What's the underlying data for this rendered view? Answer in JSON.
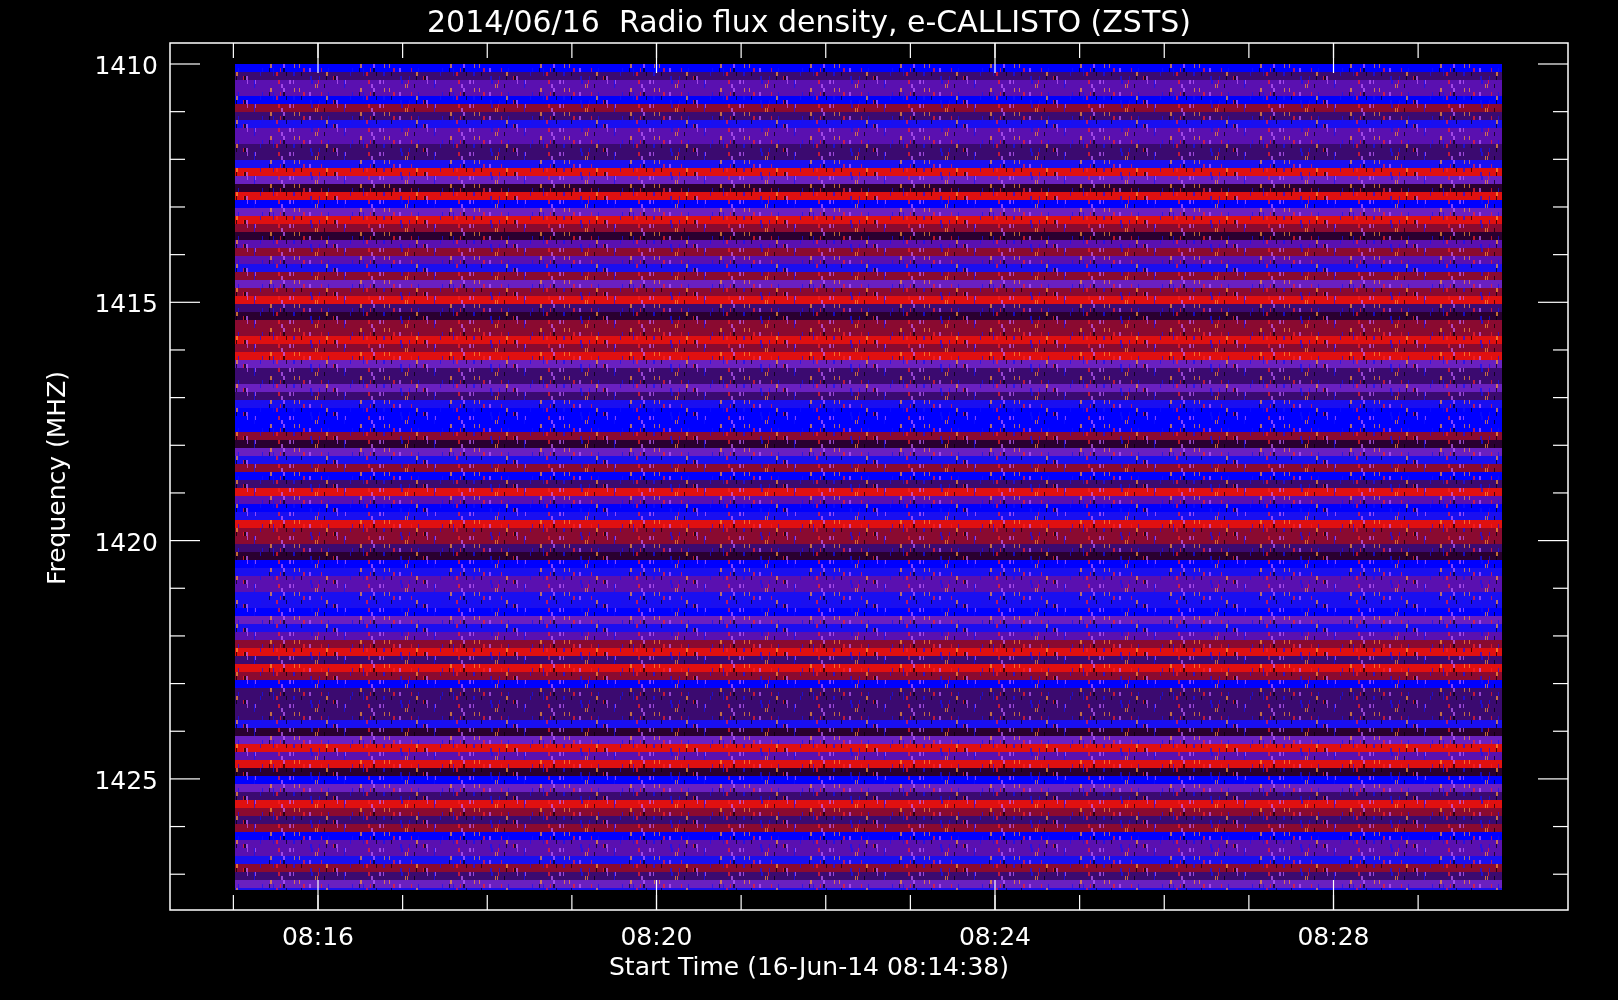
{
  "title": "2014/06/16  Radio flux density, e-CALLISTO (ZSTS)",
  "y_axis": {
    "label": "Frequency (MHZ)",
    "ticks": [
      "1410",
      "1415",
      "1420",
      "1425"
    ]
  },
  "x_axis": {
    "label": "Start Time (16-Jun-14 08:14:38)",
    "ticks": [
      "08:16",
      "08:20",
      "08:24",
      "08:28"
    ]
  }
}
